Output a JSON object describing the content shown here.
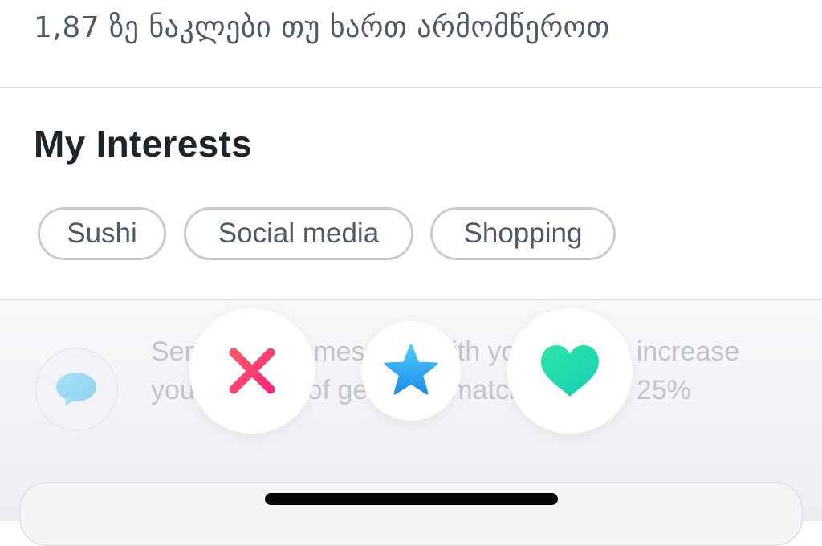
{
  "profile": {
    "distance_text": "1,87 ზე ნაკლები თუ ხართ არმომწეროთ"
  },
  "interests": {
    "title": "My Interests",
    "chips": [
      "Sushi",
      "Social media",
      "Shopping"
    ]
  },
  "promo": {
    "icon": "chat-bubble-icon",
    "text": "Send them a message with your Like to increase your chance of getting a match by up to 25%"
  },
  "actions": {
    "nope": {
      "icon": "close-icon",
      "color": "#fd4f68"
    },
    "super_like": {
      "icon": "star-icon",
      "color": "#2fa8ff"
    },
    "like": {
      "icon": "heart-icon",
      "color": "#1ed8a8"
    }
  },
  "colors": {
    "text_primary": "#1f232a",
    "text_secondary": "#505965",
    "chip_border": "#c8ccd2"
  }
}
